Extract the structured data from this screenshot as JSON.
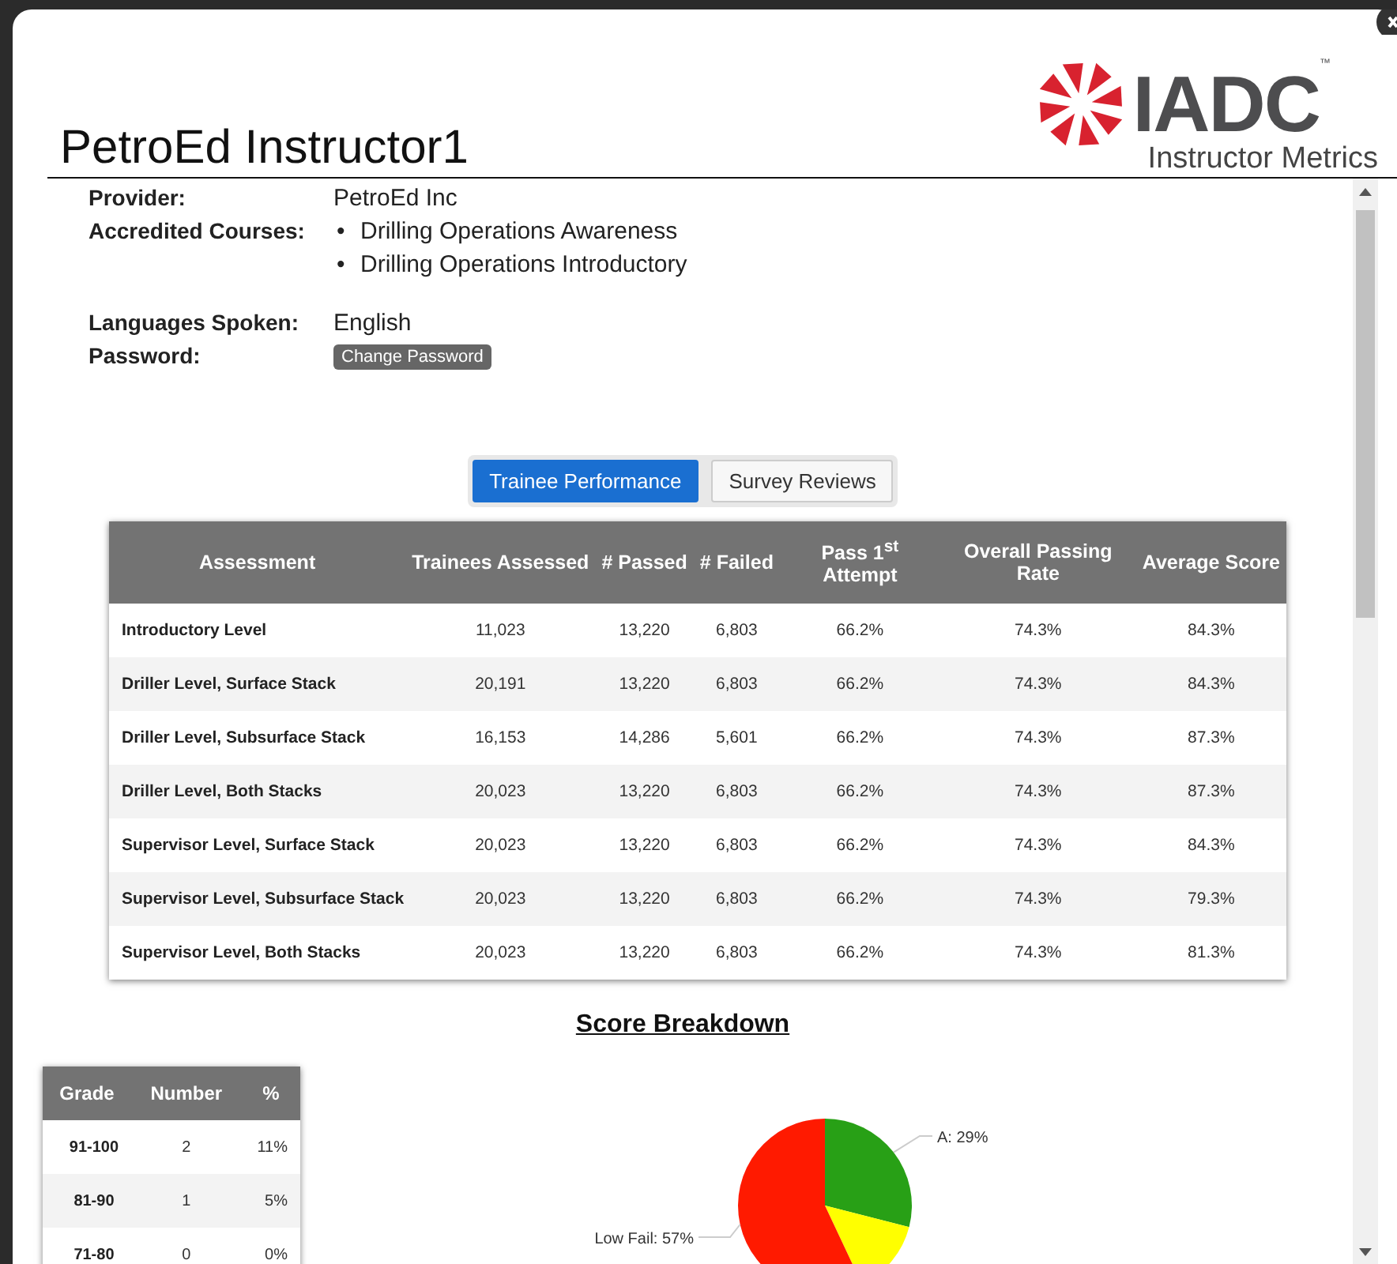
{
  "header": {
    "title": "PetroEd Instructor1",
    "logo_text": "IADC",
    "logo_mark": "™",
    "subtitle": "Instructor Metrics"
  },
  "profile": {
    "provider_label": "Provider:",
    "provider": "PetroEd Inc",
    "courses_label": "Accredited Courses:",
    "course_marker": "•",
    "courses": [
      "Drilling Operations Awareness",
      "Drilling Operations Introductory"
    ],
    "languages_label": "Languages Spoken:",
    "languages": "English",
    "password_label": "Password:",
    "password_button": "Change Password"
  },
  "tabs": [
    {
      "label": "Trainee Performance",
      "selected": true
    },
    {
      "label": "Survey Reviews",
      "selected": false
    }
  ],
  "table": {
    "columns": [
      "Assessment",
      "Trainees Assessed",
      "# Passed",
      "# Failed",
      "Pass 1$^{st}$ Attempt",
      "Overall Passing Rate",
      "Average Score"
    ],
    "rows": [
      [
        "Introductory Level",
        "11,023",
        "13,220",
        "6,803",
        "66.2%",
        "74.3%",
        "84.3%"
      ],
      [
        "Driller Level, Surface Stack",
        "20,191",
        "13,220",
        "6,803",
        "66.2%",
        "74.3%",
        "84.3%"
      ],
      [
        "Driller Level, Subsurface Stack",
        "16,153",
        "14,286",
        "5,601",
        "66.2%",
        "74.3%",
        "87.3%"
      ],
      [
        "Driller Level, Both Stacks",
        "20,023",
        "13,220",
        "6,803",
        "66.2%",
        "74.3%",
        "87.3%"
      ],
      [
        "Supervisor Level, Surface Stack",
        "20,023",
        "13,220",
        "6,803",
        "66.2%",
        "74.3%",
        "84.3%"
      ],
      [
        "Supervisor Level, Subsurface Stack",
        "20,023",
        "13,220",
        "6,803",
        "66.2%",
        "74.3%",
        "79.3%"
      ],
      [
        "Supervisor Level, Both Stacks",
        "20,023",
        "13,220",
        "6,803",
        "66.2%",
        "74.3%",
        "81.3%"
      ]
    ]
  },
  "score_breakdown": {
    "title": "Score Breakdown",
    "grades": {
      "columns": [
        "Grade",
        "Number",
        "%"
      ],
      "rows": [
        [
          "91-100",
          "2",
          "11%"
        ],
        [
          "81-90",
          "1",
          "5%"
        ],
        [
          "71-80",
          "0",
          "0%"
        ]
      ]
    },
    "chart_data": {
      "type": "pie",
      "categories": [
        "A: 29%",
        null,
        "Low Fail: 57%"
      ],
      "values": [
        29,
        14,
        57
      ],
      "colors": [
        "#28a016",
        "#ffff00",
        "#ff1a00"
      ]
    }
  }
}
